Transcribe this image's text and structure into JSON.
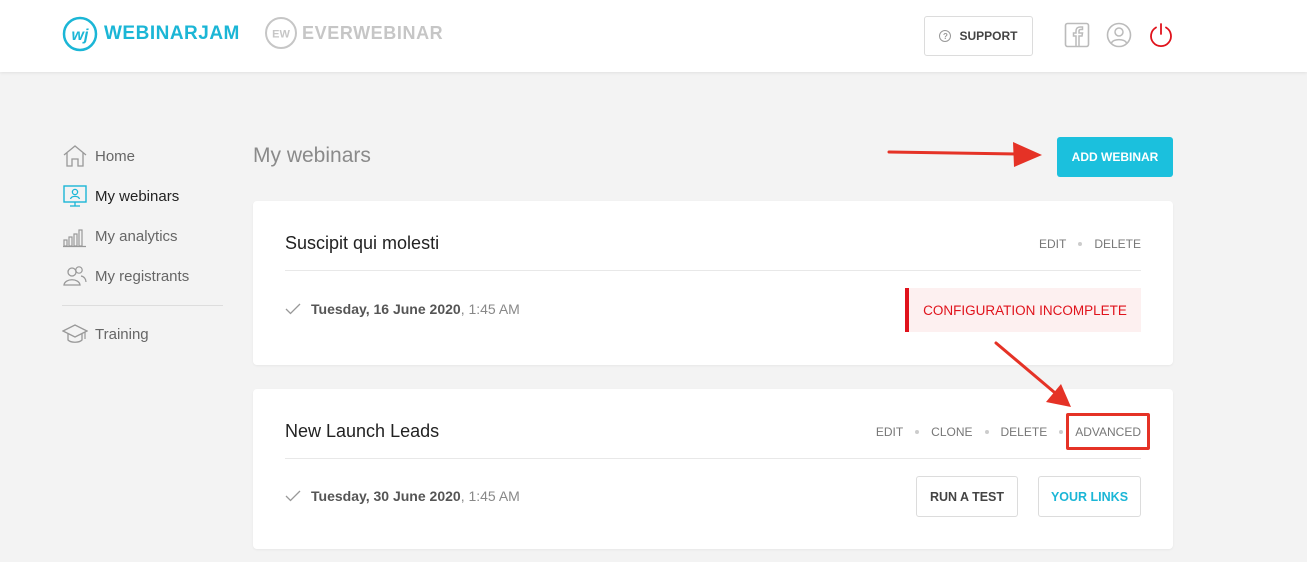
{
  "header": {
    "brand_primary": "WEBINARJAM",
    "brand_primary_mark": "wj",
    "brand_secondary": "EVERWEBINAR",
    "brand_secondary_mark": "EW",
    "support_label": "SUPPORT",
    "support_icon_glyph": "?",
    "icons": [
      "facebook-icon",
      "user-profile-icon",
      "power-icon"
    ]
  },
  "sidebar": {
    "items": [
      {
        "label": "Home",
        "icon": "home-icon",
        "active": false
      },
      {
        "label": "My webinars",
        "icon": "monitor-icon",
        "active": true
      },
      {
        "label": "My analytics",
        "icon": "bar-chart-icon",
        "active": false
      },
      {
        "label": "My registrants",
        "icon": "users-icon",
        "active": false
      }
    ],
    "secondary_items": [
      {
        "label": "Training",
        "icon": "graduation-cap-icon",
        "active": false
      }
    ]
  },
  "main": {
    "title": "My webinars",
    "add_button_label": "ADD WEBINAR",
    "webinars": [
      {
        "name": "Suscipit qui molesti",
        "actions": [
          "EDIT",
          "DELETE"
        ],
        "date": "Tuesday, 16 June 2020",
        "time": ", 1:45 AM",
        "status": "CONFIGURATION INCOMPLETE"
      },
      {
        "name": "New Launch Leads",
        "actions": [
          "EDIT",
          "CLONE",
          "DELETE",
          "ADVANCED"
        ],
        "date": "Tuesday, 30 June 2020",
        "time": ", 1:45 AM",
        "buttons": [
          "RUN A TEST",
          "YOUR LINKS"
        ]
      }
    ]
  },
  "colors": {
    "accent": "#1bc0dd",
    "brand": "#1bb6d6",
    "error": "#e0121b",
    "annotation": "#e53226"
  }
}
